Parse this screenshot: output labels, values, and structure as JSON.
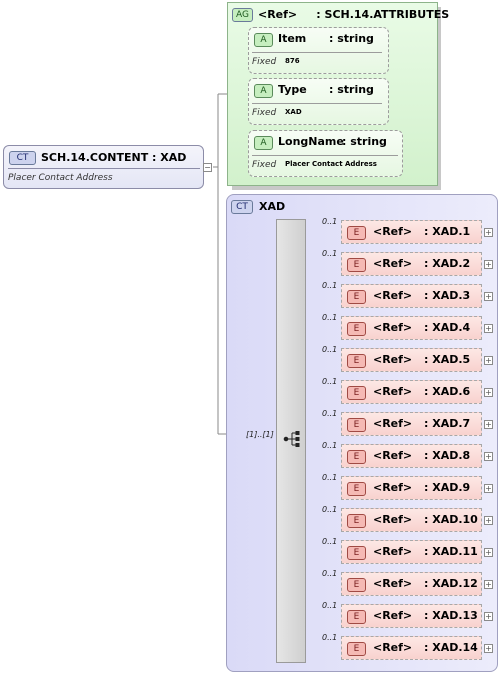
{
  "root": {
    "badge": "CT",
    "title": "SCH.14.CONTENT : XAD",
    "documentation": "Placer Contact Address",
    "expander": "−"
  },
  "attribute_group": {
    "badge": "AG",
    "title": "<Ref>     : SCH.14.ATTRIBUTES",
    "attributes": [
      {
        "badge": "A",
        "name": "Item",
        "type": ": string",
        "fixed_label": "Fixed",
        "fixed_value": "876"
      },
      {
        "badge": "A",
        "name": "Type",
        "type": ": string",
        "fixed_label": "Fixed",
        "fixed_value": "XAD"
      },
      {
        "badge": "A",
        "name": "LongName",
        "type": ": string",
        "fixed_label": "Fixed",
        "fixed_value": "Placer Contact Address"
      }
    ]
  },
  "complex_type": {
    "badge": "CT",
    "title": "XAD",
    "sequence_occurrence": "[1]..[1]"
  },
  "elements": [
    {
      "badge": "E",
      "ref": "<Ref>",
      "name": ": XAD.1",
      "occurrence": "0..1",
      "expander": "+"
    },
    {
      "badge": "E",
      "ref": "<Ref>",
      "name": ": XAD.2",
      "occurrence": "0..1",
      "expander": "+"
    },
    {
      "badge": "E",
      "ref": "<Ref>",
      "name": ": XAD.3",
      "occurrence": "0..1",
      "expander": "+"
    },
    {
      "badge": "E",
      "ref": "<Ref>",
      "name": ": XAD.4",
      "occurrence": "0..1",
      "expander": "+"
    },
    {
      "badge": "E",
      "ref": "<Ref>",
      "name": ": XAD.5",
      "occurrence": "0..1",
      "expander": "+"
    },
    {
      "badge": "E",
      "ref": "<Ref>",
      "name": ": XAD.6",
      "occurrence": "0..1",
      "expander": "+"
    },
    {
      "badge": "E",
      "ref": "<Ref>",
      "name": ": XAD.7",
      "occurrence": "0..1",
      "expander": "+"
    },
    {
      "badge": "E",
      "ref": "<Ref>",
      "name": ": XAD.8",
      "occurrence": "0..1",
      "expander": "+"
    },
    {
      "badge": "E",
      "ref": "<Ref>",
      "name": ": XAD.9",
      "occurrence": "0..1",
      "expander": "+"
    },
    {
      "badge": "E",
      "ref": "<Ref>",
      "name": ": XAD.10",
      "occurrence": "0..1",
      "expander": "+"
    },
    {
      "badge": "E",
      "ref": "<Ref>",
      "name": ": XAD.11",
      "occurrence": "0..1",
      "expander": "+"
    },
    {
      "badge": "E",
      "ref": "<Ref>",
      "name": ": XAD.12",
      "occurrence": "0..1",
      "expander": "+"
    },
    {
      "badge": "E",
      "ref": "<Ref>",
      "name": ": XAD.13",
      "occurrence": "0..1",
      "expander": "+"
    },
    {
      "badge": "E",
      "ref": "<Ref>",
      "name": ": XAD.14",
      "occurrence": "0..1",
      "expander": "+"
    }
  ]
}
